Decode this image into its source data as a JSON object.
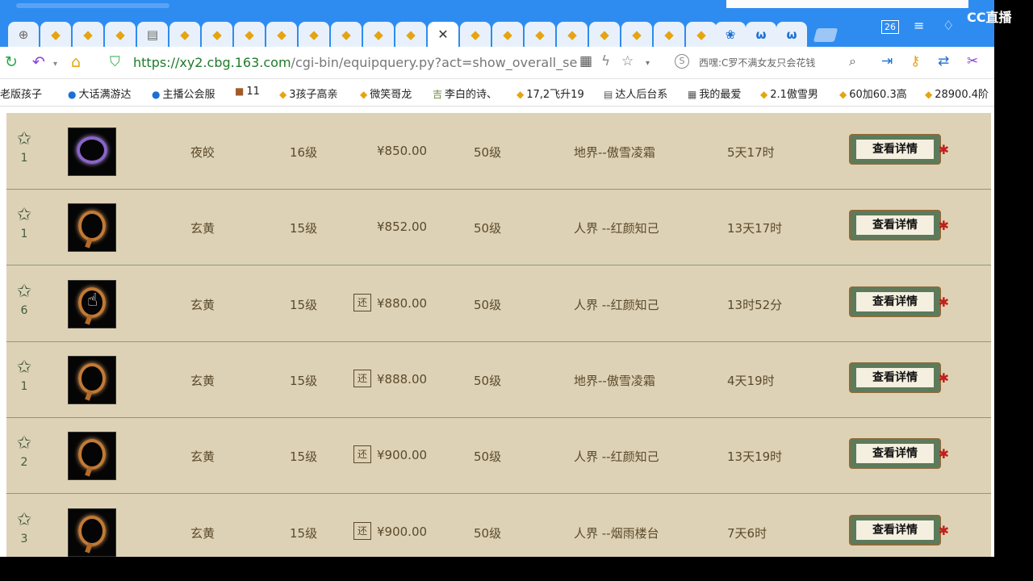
{
  "browser": {
    "url_host": "https://xy2.cbg.163.com",
    "url_path": "/cgi-bin/equipquery.py?act=show_overall_search_",
    "search_text": "西嘿:C罗不满女友只会花钱",
    "tab_count": "26",
    "watermark": "CC直播"
  },
  "bookmarks": [
    {
      "label": "老版孩子"
    },
    {
      "label": "大话满游达"
    },
    {
      "label": "主播公会服"
    },
    {
      "label": "11"
    },
    {
      "label": "3孩子高亲"
    },
    {
      "label": "微笑哥龙"
    },
    {
      "label": "李白的诗、"
    },
    {
      "label": "17,2飞升19"
    },
    {
      "label": "达人后台系"
    },
    {
      "label": "我的最爱"
    },
    {
      "label": "2.1傲雪男"
    },
    {
      "label": "60加60.3高"
    },
    {
      "label": "28900.4阶"
    }
  ],
  "detail_label": "查看详情",
  "tag_label": "还",
  "rows": [
    {
      "fav": "1",
      "name": "夜皎",
      "level": "16级",
      "price": "¥850.00",
      "has_tag": false,
      "req": "50级",
      "server": "地界--傲雪凌霜",
      "time": "5天17时",
      "img": "purple"
    },
    {
      "fav": "1",
      "name": "玄黄",
      "level": "15级",
      "price": "¥852.00",
      "has_tag": false,
      "req": "50级",
      "server": "人界 --红颜知己",
      "time": "13天17时",
      "img": "gold"
    },
    {
      "fav": "6",
      "name": "玄黄",
      "level": "15级",
      "price": "¥880.00",
      "has_tag": true,
      "req": "50级",
      "server": "人界 --红颜知己",
      "time": "13时52分",
      "img": "gold"
    },
    {
      "fav": "1",
      "name": "玄黄",
      "level": "15级",
      "price": "¥888.00",
      "has_tag": true,
      "req": "50级",
      "server": "地界--傲雪凌霜",
      "time": "4天19时",
      "img": "gold"
    },
    {
      "fav": "2",
      "name": "玄黄",
      "level": "15级",
      "price": "¥900.00",
      "has_tag": true,
      "req": "50级",
      "server": "人界 --红颜知己",
      "time": "13天19时",
      "img": "gold"
    },
    {
      "fav": "3",
      "name": "玄黄",
      "level": "15级",
      "price": "¥900.00",
      "has_tag": true,
      "req": "50级",
      "server": "人界 --烟雨楼台",
      "time": "7天6时",
      "img": "gold"
    }
  ]
}
